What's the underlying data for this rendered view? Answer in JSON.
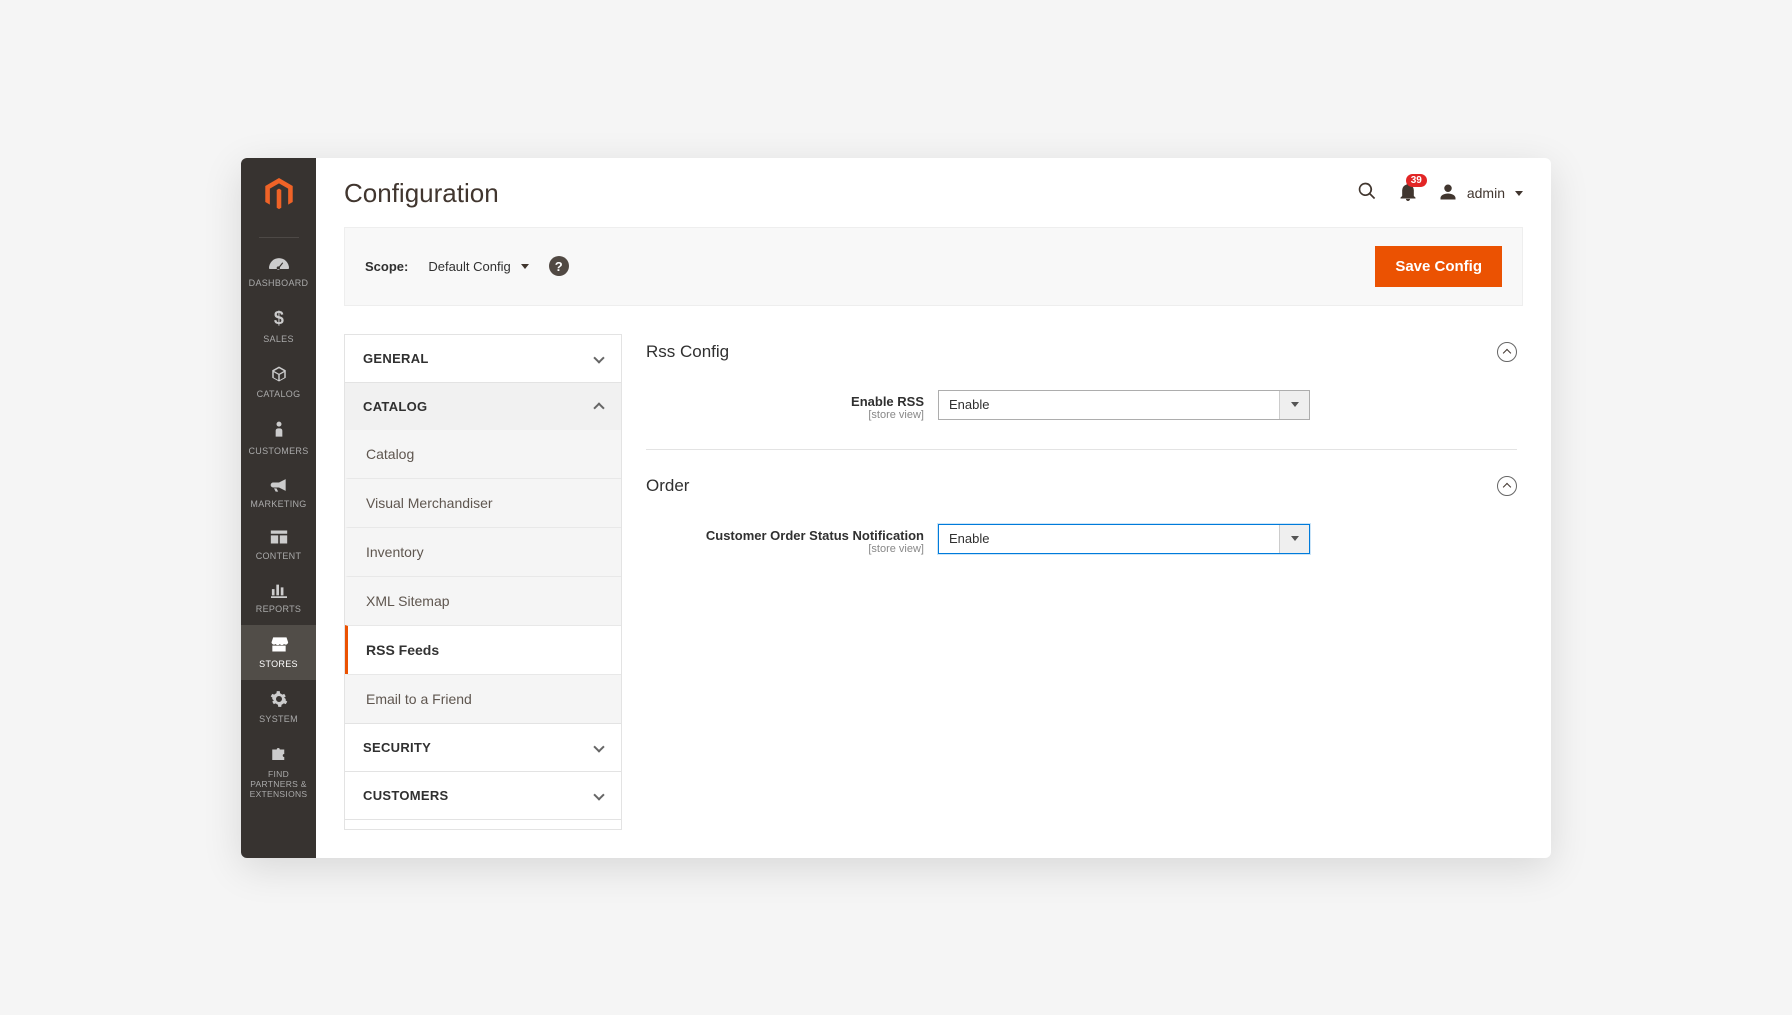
{
  "header": {
    "title": "Configuration",
    "notifications": "39",
    "username": "admin"
  },
  "scope": {
    "label": "Scope:",
    "value": "Default Config",
    "save_button": "Save Config"
  },
  "sidebar": {
    "items": [
      {
        "label": "Dashboard"
      },
      {
        "label": "Sales"
      },
      {
        "label": "Catalog"
      },
      {
        "label": "Customers"
      },
      {
        "label": "Marketing"
      },
      {
        "label": "Content"
      },
      {
        "label": "Reports"
      },
      {
        "label": "Stores"
      },
      {
        "label": "System"
      },
      {
        "label": "Find Partners & Extensions"
      }
    ]
  },
  "config_nav": {
    "sections": [
      {
        "label": "General",
        "expanded": false
      },
      {
        "label": "Catalog",
        "expanded": true,
        "items": [
          {
            "label": "Catalog"
          },
          {
            "label": "Visual Merchandiser"
          },
          {
            "label": "Inventory"
          },
          {
            "label": "XML Sitemap"
          },
          {
            "label": "RSS Feeds",
            "active": true
          },
          {
            "label": "Email to a Friend"
          }
        ]
      },
      {
        "label": "Security",
        "expanded": false
      },
      {
        "label": "Customers",
        "expanded": false
      }
    ]
  },
  "config_main": {
    "rss_config": {
      "title": "Rss Config",
      "enable_rss_label": "Enable RSS",
      "enable_rss_scope": "[store view]",
      "enable_rss_value": "Enable"
    },
    "order": {
      "title": "Order",
      "custnotif_label": "Customer Order Status Notification",
      "custnotif_scope": "[store view]",
      "custnotif_value": "Enable"
    }
  }
}
